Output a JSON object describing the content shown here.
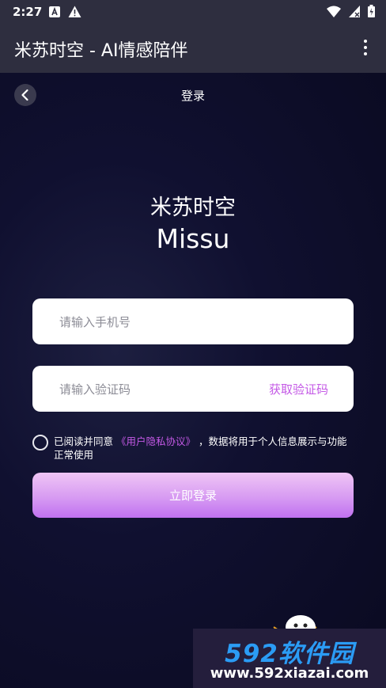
{
  "status_bar": {
    "time": "2:27",
    "icons": [
      "a-notification-icon",
      "warning-icon",
      "wifi-icon",
      "signal-icon",
      "battery-icon"
    ]
  },
  "app_bar": {
    "title": "米苏时空 - AI情感陪伴",
    "menu_icon": "more-vert-icon"
  },
  "header": {
    "back_icon": "chevron-left-icon",
    "title": "登录"
  },
  "brand": {
    "name_cn": "米苏时空",
    "name_en": "Missu"
  },
  "form": {
    "phone_placeholder": "请输入手机号",
    "phone_value": "",
    "code_placeholder": "请输入验证码",
    "code_value": "",
    "get_code_label": "获取验证码"
  },
  "agreement": {
    "checked": false,
    "prefix": "已阅读并同意",
    "link": "《用户隐私协议》",
    "suffix": "，数据将用于个人信息展示与功能正常使用"
  },
  "login_button": "立即登录",
  "watermark": {
    "line1": "592软件园",
    "line2": "www.592xiazai.com"
  },
  "colors": {
    "accent": "#c459e6",
    "bar": "#2e2e3f",
    "background": "#0b0b22"
  }
}
